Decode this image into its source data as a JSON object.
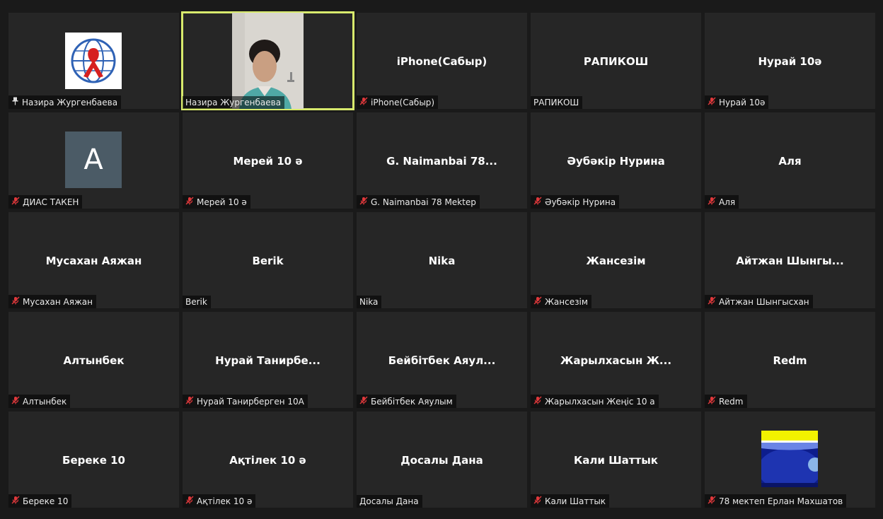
{
  "tiles": [
    {
      "type": "logo",
      "name": "Назира Жургенбаева",
      "pinned": true,
      "muted": false
    },
    {
      "type": "video",
      "name": "Назира Жургенбаева",
      "active": true,
      "muted": false
    },
    {
      "type": "name",
      "display": "iPhone(Сабыр)",
      "name": "iPhone(Сабыр)",
      "muted": true
    },
    {
      "type": "name",
      "display": "РАПИКОШ",
      "name": "РАПИКОШ",
      "muted": false
    },
    {
      "type": "name",
      "display": "Нурай 10ә",
      "name": "Нурай 10ә",
      "muted": true
    },
    {
      "type": "avatar",
      "initial": "A",
      "name": "ДИАС ТАКЕН",
      "muted": true
    },
    {
      "type": "name",
      "display": "Мерей 10 ә",
      "name": "Мерей 10 ә",
      "muted": true
    },
    {
      "type": "name",
      "display": "G. Naimanbai 78...",
      "name": "G. Naimanbai 78 Mektep",
      "muted": true
    },
    {
      "type": "name",
      "display": "Әубәкір Нурина",
      "name": "Әубәкір Нурина",
      "muted": true
    },
    {
      "type": "name",
      "display": "Аля",
      "name": "Аля",
      "muted": true
    },
    {
      "type": "name",
      "display": "Мусахан Аяжан",
      "name": "Мусахан Аяжан",
      "muted": true
    },
    {
      "type": "name",
      "display": "Berik",
      "name": "Berik",
      "muted": false
    },
    {
      "type": "name",
      "display": "Nika",
      "name": "Nika",
      "muted": false
    },
    {
      "type": "name",
      "display": "Жансезім",
      "name": "Жансезім",
      "muted": true
    },
    {
      "type": "name",
      "display": "Айтжан Шынгы...",
      "name": "Айтжан Шынгысхан",
      "muted": true
    },
    {
      "type": "name",
      "display": "Алтынбек",
      "name": "Алтынбек",
      "muted": true
    },
    {
      "type": "name",
      "display": "Нурай Танирбе...",
      "name": "Нурай Танирберген 10А",
      "muted": true
    },
    {
      "type": "name",
      "display": "Бейбітбек Аяул...",
      "name": "Бейбітбек Аяулым",
      "muted": true
    },
    {
      "type": "name",
      "display": "Жарылхасын Ж...",
      "name": "Жарылхасын Жеңіс 10 а",
      "muted": true
    },
    {
      "type": "name",
      "display": "Redm",
      "name": "Redm",
      "muted": true
    },
    {
      "type": "name",
      "display": "Береке 10",
      "name": "Береке 10",
      "muted": true
    },
    {
      "type": "name",
      "display": "Ақтілек 10 ә",
      "name": "Ақтілек 10 ә",
      "muted": true
    },
    {
      "type": "name",
      "display": "Досалы Дана",
      "name": "Досалы Дана",
      "muted": false
    },
    {
      "type": "name",
      "display": "Кали Шаттык",
      "name": "Кали Шаттык",
      "muted": true
    },
    {
      "type": "shared",
      "name": "78 мектеп Ерлан Махшатов",
      "muted": true
    }
  ],
  "colors": {
    "active_border": "#d8ea6d",
    "muted_icon": "#e0383b",
    "avatar_bg": "#4b5b66"
  }
}
